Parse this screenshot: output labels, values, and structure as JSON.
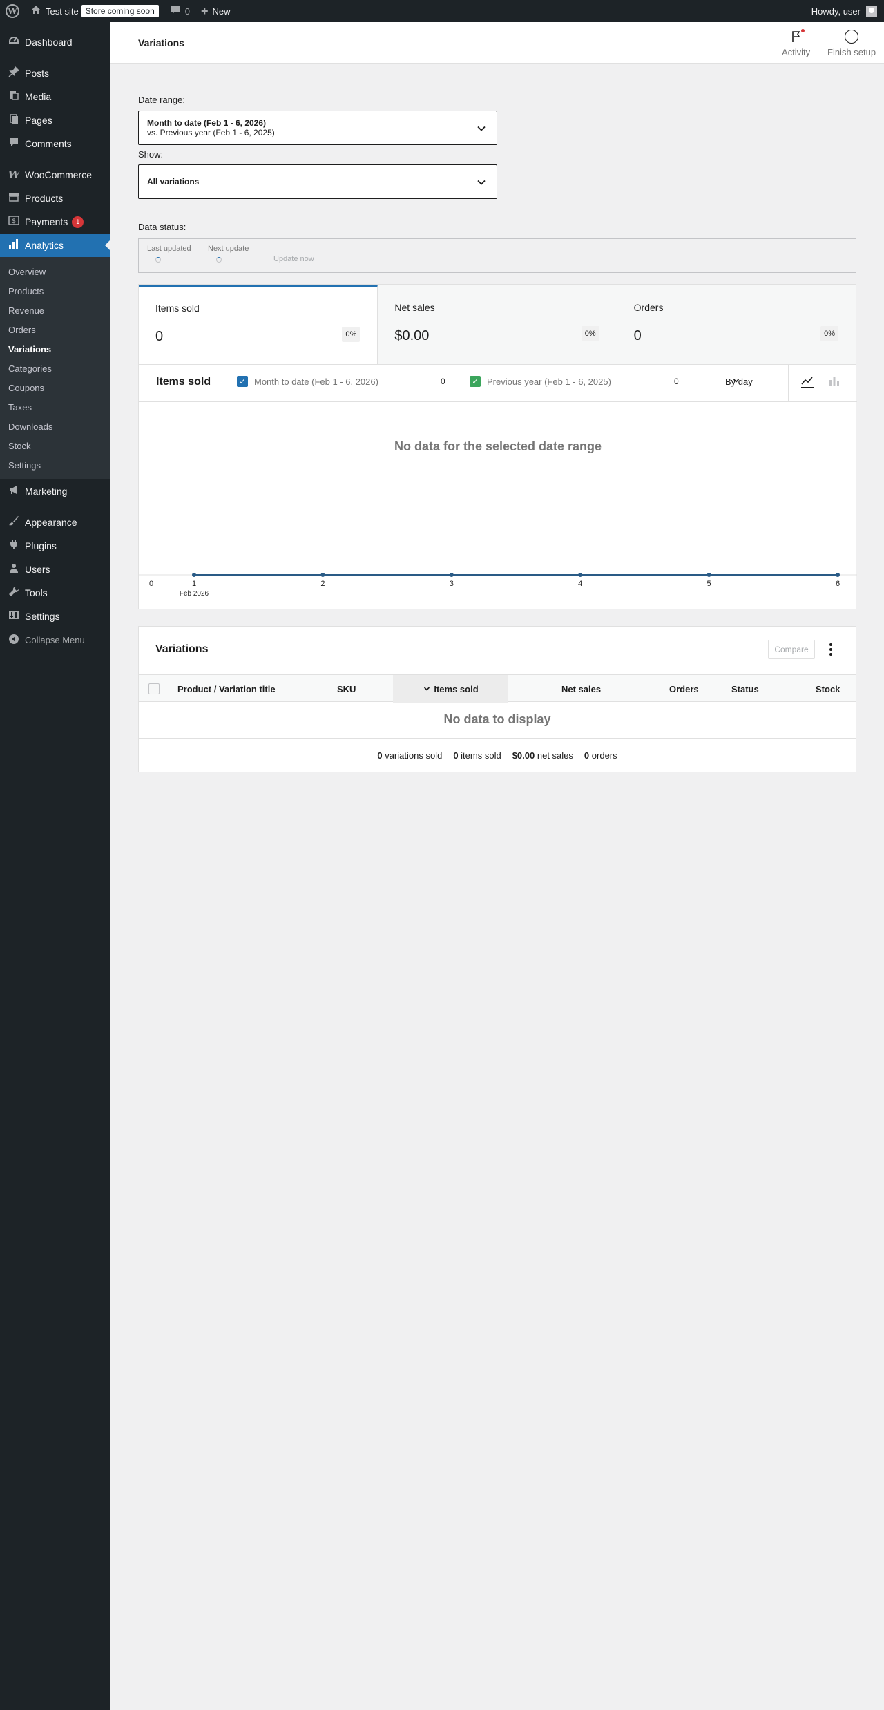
{
  "admin_bar": {
    "site_name": "Test site",
    "store_badge": "Store coming soon",
    "comments_count": "0",
    "new_label": "New",
    "howdy": "Howdy, user"
  },
  "sidebar": {
    "items": [
      {
        "label": "Dashboard",
        "icon": "dashboard-icon"
      },
      {
        "label": "Posts",
        "icon": "pin-icon"
      },
      {
        "label": "Media",
        "icon": "media-icon"
      },
      {
        "label": "Pages",
        "icon": "page-icon"
      },
      {
        "label": "Comments",
        "icon": "comment-icon"
      },
      {
        "label": "WooCommerce",
        "icon": "woo-icon"
      },
      {
        "label": "Products",
        "icon": "archive-icon"
      },
      {
        "label": "Payments",
        "icon": "dollar-icon",
        "badge": "1"
      },
      {
        "label": "Analytics",
        "icon": "bar-chart-icon"
      },
      {
        "label": "Marketing",
        "icon": "megaphone-icon"
      },
      {
        "label": "Appearance",
        "icon": "brush-icon"
      },
      {
        "label": "Plugins",
        "icon": "plug-icon"
      },
      {
        "label": "Users",
        "icon": "user-icon"
      },
      {
        "label": "Tools",
        "icon": "wrench-icon"
      },
      {
        "label": "Settings",
        "icon": "settings-icon"
      }
    ],
    "submenu": [
      "Overview",
      "Products",
      "Revenue",
      "Orders",
      "Variations",
      "Categories",
      "Coupons",
      "Taxes",
      "Downloads",
      "Stock",
      "Settings"
    ],
    "collapse_label": "Collapse Menu"
  },
  "header": {
    "title": "Variations",
    "activity_label": "Activity",
    "finish_setup_label": "Finish setup"
  },
  "filters": {
    "date_range_label": "Date range:",
    "date_range_primary": "Month to date (Feb 1 - 6, 2026)",
    "date_range_secondary": "vs. Previous year (Feb 1 - 6, 2025)",
    "show_label": "Show:",
    "show_value": "All variations"
  },
  "data_status": {
    "label": "Data status:",
    "last_updated": "Last updated",
    "next_update": "Next update",
    "update_now": "Update now"
  },
  "summary": [
    {
      "label": "Items sold",
      "value": "0",
      "delta": "0%"
    },
    {
      "label": "Net sales",
      "value": "$0.00",
      "delta": "0%"
    },
    {
      "label": "Orders",
      "value": "0",
      "delta": "0%"
    }
  ],
  "chart": {
    "title": "Items sold",
    "legend_primary": "Month to date (Feb 1 - 6, 2026)",
    "legend_primary_value": "0",
    "legend_secondary": "Previous year (Feb 1 - 6, 2025)",
    "legend_secondary_value": "0",
    "interval": "By day",
    "no_data": "No data for the selected date range",
    "colors": {
      "primary": "#2271b1",
      "secondary": "#3ba55c"
    }
  },
  "chart_data": {
    "type": "line",
    "x": [
      "1",
      "2",
      "3",
      "4",
      "5",
      "6"
    ],
    "x_sublabel": "Feb 2026",
    "y_tick": "0",
    "series": [
      {
        "name": "Month to date (Feb 1 - 6, 2026)",
        "values": [
          0,
          0,
          0,
          0,
          0,
          0
        ]
      },
      {
        "name": "Previous year (Feb 1 - 6, 2025)",
        "values": [
          0,
          0,
          0,
          0,
          0,
          0
        ]
      }
    ]
  },
  "table": {
    "title": "Variations",
    "compare_label": "Compare",
    "columns": [
      "Product / Variation title",
      "SKU",
      "Items sold",
      "Net sales",
      "Orders",
      "Status",
      "Stock"
    ],
    "no_data": "No data to display",
    "summary": [
      {
        "value": "0",
        "label": "variations sold"
      },
      {
        "value": "0",
        "label": "items sold"
      },
      {
        "value": "$0.00",
        "label": "net sales"
      },
      {
        "value": "0",
        "label": "orders"
      }
    ]
  }
}
